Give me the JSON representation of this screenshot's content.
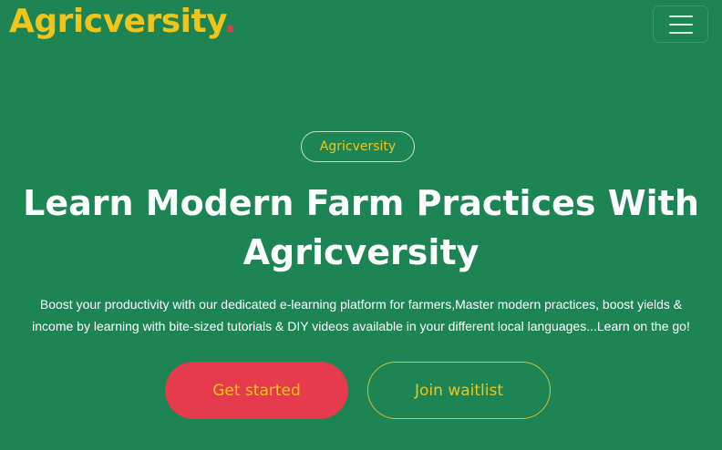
{
  "header": {
    "logo_text": "Agricversity",
    "logo_dot": ".",
    "menu_icon": "hamburger-icon"
  },
  "hero": {
    "badge": "Agricversity",
    "headline_line1": "Learn Modern Farm Practices With",
    "headline_line2": "Agricversity",
    "subtext_line1": "Boost your productivity with our dedicated e-learning platform for farmers,Master modern practices, boost yields &",
    "subtext_line2": "income by learning with bite-sized tutorials & DIY videos available in your different local languages...Learn on the go!",
    "primary_button": "Get started",
    "secondary_button": "Join waitlist"
  },
  "colors": {
    "background": "#1c8553",
    "accent_yellow": "#f0c419",
    "accent_red": "#e63a4d",
    "text": "#ffffff"
  }
}
